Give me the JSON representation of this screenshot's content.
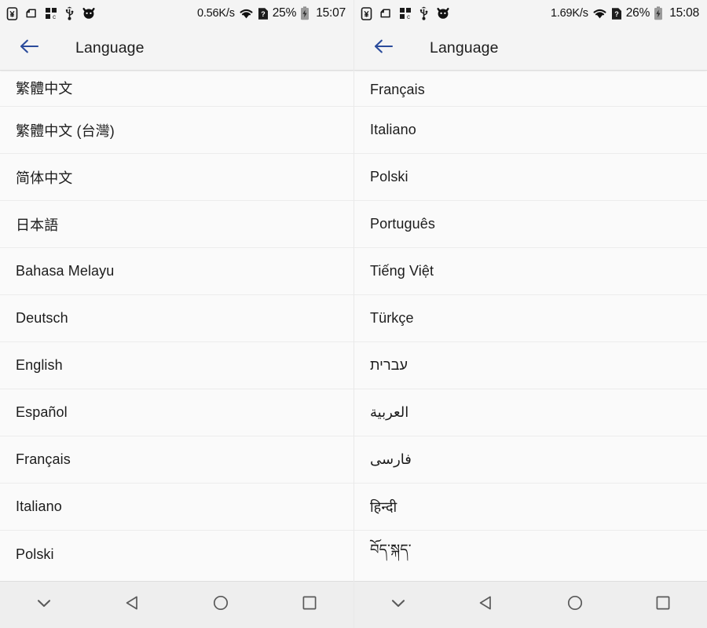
{
  "panels": [
    {
      "id": "left",
      "status_bar": {
        "icons": [
          "yen-box-icon",
          "clipboard-icon",
          "grid-apps-icon",
          "usb-icon",
          "cat-head-icon"
        ],
        "network_speed": "0.56K/s",
        "wifi_icon": "wifi-icon",
        "sim_icon": "sim-card-unknown-icon",
        "battery_percent": "25%",
        "battery_icon": "battery-charging-icon",
        "clock": "15:07"
      },
      "app_bar": {
        "back_icon": "arrow-left-icon",
        "title": "Language"
      },
      "languages": [
        "繁體中文",
        "繁體中文 (台灣)",
        "简体中文",
        "日本語",
        "Bahasa Melayu",
        "Deutsch",
        "English",
        "Español",
        "Français",
        "Italiano",
        "Polski"
      ]
    },
    {
      "id": "right",
      "status_bar": {
        "icons": [
          "yen-box-icon",
          "clipboard-icon",
          "grid-apps-icon",
          "usb-icon",
          "cat-head-icon"
        ],
        "network_speed": "1.69K/s",
        "wifi_icon": "wifi-icon",
        "sim_icon": "sim-card-unknown-icon",
        "battery_percent": "26%",
        "battery_icon": "battery-charging-icon",
        "clock": "15:08"
      },
      "app_bar": {
        "back_icon": "arrow-left-icon",
        "title": "Language"
      },
      "languages": [
        "Français",
        "Italiano",
        "Polski",
        "Português",
        "Tiếng Việt",
        "Türkçe",
        "עברית",
        "العربية",
        "فارسی",
        "हिन्दी",
        "བོད་སྐད་"
      ]
    }
  ],
  "nav_bar": {
    "buttons": [
      {
        "name": "hide-navbar-button",
        "icon": "chevron-down-icon"
      },
      {
        "name": "back-button",
        "icon": "triangle-back-icon"
      },
      {
        "name": "home-button",
        "icon": "circle-home-icon"
      },
      {
        "name": "recents-button",
        "icon": "square-recents-icon"
      }
    ]
  },
  "colors": {
    "back_arrow": "#2a4b9b",
    "app_bar_bg": "#f4f4f4",
    "list_bg": "#fafafa",
    "nav_bar_bg": "#eeeeee",
    "divider": "#ececec",
    "text": "#1c1c1c"
  }
}
